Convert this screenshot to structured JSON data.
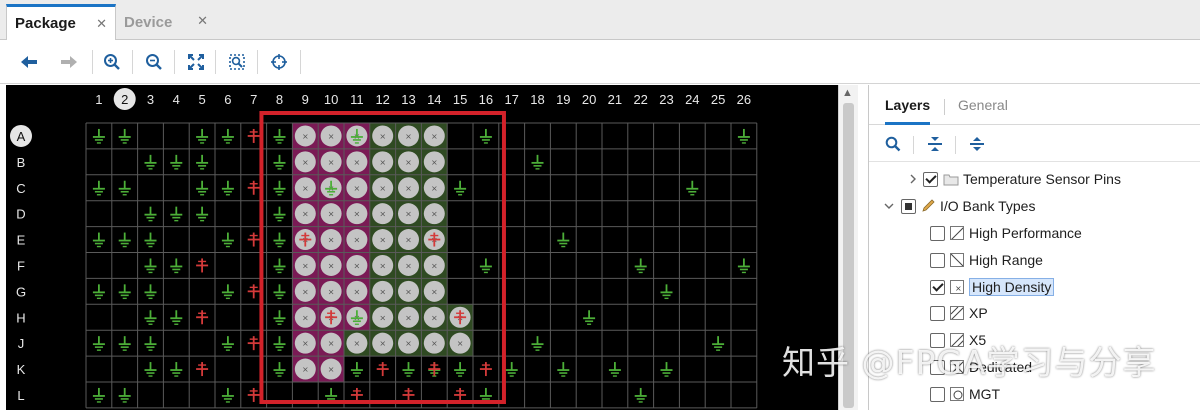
{
  "tabs": [
    {
      "label": "Package",
      "active": true
    },
    {
      "label": "Device",
      "active": false
    }
  ],
  "toolbar_icons": [
    "back-arrow-icon",
    "forward-arrow-icon",
    "zoom-in-icon",
    "zoom-out-icon",
    "zoom-fit-icon",
    "zoom-area-icon",
    "crosshair-icon"
  ],
  "package_view": {
    "columns": [
      "1",
      "2",
      "3",
      "4",
      "5",
      "6",
      "7",
      "8",
      "9",
      "10",
      "11",
      "12",
      "13",
      "14",
      "15",
      "16",
      "17",
      "18",
      "19",
      "20",
      "21",
      "22",
      "23",
      "24",
      "25",
      "26"
    ],
    "rows": [
      "A",
      "B",
      "C",
      "D",
      "E",
      "F",
      "G",
      "H",
      "J",
      "K",
      "L"
    ],
    "selected_column": "2",
    "selected_row": "A",
    "ground_pins": [
      [
        1,
        0
      ],
      [
        2,
        0
      ],
      [
        5,
        0
      ],
      [
        6,
        0
      ],
      [
        8,
        0
      ],
      [
        11,
        0
      ],
      [
        16,
        0
      ],
      [
        26,
        0
      ],
      [
        3,
        1
      ],
      [
        4,
        1
      ],
      [
        5,
        1
      ],
      [
        8,
        1
      ],
      [
        18,
        1
      ],
      [
        1,
        2
      ],
      [
        2,
        2
      ],
      [
        5,
        2
      ],
      [
        6,
        2
      ],
      [
        8,
        2
      ],
      [
        10,
        2
      ],
      [
        15,
        2
      ],
      [
        24,
        2
      ],
      [
        3,
        3
      ],
      [
        4,
        3
      ],
      [
        5,
        3
      ],
      [
        8,
        3
      ],
      [
        1,
        4
      ],
      [
        2,
        4
      ],
      [
        3,
        4
      ],
      [
        6,
        4
      ],
      [
        8,
        4
      ],
      [
        19,
        4
      ],
      [
        3,
        5
      ],
      [
        4,
        5
      ],
      [
        8,
        5
      ],
      [
        16,
        5
      ],
      [
        22,
        5
      ],
      [
        26,
        5
      ],
      [
        1,
        6
      ],
      [
        2,
        6
      ],
      [
        3,
        6
      ],
      [
        6,
        6
      ],
      [
        8,
        6
      ],
      [
        23,
        6
      ],
      [
        3,
        7
      ],
      [
        4,
        7
      ],
      [
        8,
        7
      ],
      [
        11,
        7
      ],
      [
        20,
        7
      ],
      [
        1,
        8
      ],
      [
        2,
        8
      ],
      [
        3,
        8
      ],
      [
        6,
        8
      ],
      [
        8,
        8
      ],
      [
        18,
        8
      ],
      [
        25,
        8
      ],
      [
        3,
        9
      ],
      [
        4,
        9
      ],
      [
        8,
        9
      ],
      [
        11,
        9
      ],
      [
        13,
        9
      ],
      [
        14,
        9
      ],
      [
        15,
        9
      ],
      [
        17,
        9
      ],
      [
        19,
        9
      ],
      [
        21,
        9
      ],
      [
        23,
        9
      ],
      [
        1,
        10
      ],
      [
        2,
        10
      ],
      [
        6,
        10
      ],
      [
        10,
        10
      ],
      [
        16,
        10
      ],
      [
        22,
        10
      ]
    ],
    "power_pins": [
      [
        7,
        0
      ],
      [
        7,
        2
      ],
      [
        7,
        4
      ],
      [
        5,
        5
      ],
      [
        7,
        6
      ],
      [
        5,
        7
      ],
      [
        7,
        8
      ],
      [
        9,
        4
      ],
      [
        14,
        4
      ],
      [
        10,
        7
      ],
      [
        15,
        7
      ],
      [
        5,
        9
      ],
      [
        7,
        10
      ],
      [
        12,
        9
      ],
      [
        14,
        9
      ],
      [
        16,
        9
      ],
      [
        11,
        10
      ],
      [
        13,
        10
      ],
      [
        15,
        10
      ]
    ],
    "bank_a_rows": [
      [
        0,
        9,
        11
      ],
      [
        1,
        9,
        11
      ],
      [
        2,
        9,
        11
      ],
      [
        3,
        9,
        11
      ],
      [
        4,
        9,
        11
      ],
      [
        5,
        9,
        11
      ],
      [
        6,
        9,
        11
      ],
      [
        7,
        9,
        11
      ],
      [
        8,
        9,
        11
      ],
      [
        9,
        9,
        10
      ]
    ],
    "bank_b_rows": [
      [
        0,
        12,
        14
      ],
      [
        1,
        12,
        14
      ],
      [
        2,
        12,
        14
      ],
      [
        3,
        12,
        14
      ],
      [
        4,
        12,
        14
      ],
      [
        5,
        12,
        14
      ],
      [
        6,
        12,
        14
      ],
      [
        7,
        12,
        15
      ],
      [
        8,
        11,
        15
      ]
    ],
    "colors": {
      "bank_a": "#7a1a55",
      "bank_b": "#2f4a22",
      "ground": "#4caf38",
      "power": "#d43a3a",
      "selection": "#d3222a"
    }
  },
  "layers_panel": {
    "tabs": [
      "Layers",
      "General"
    ],
    "tool_icons": [
      "search-icon",
      "collapse-all-icon",
      "expand-all-icon"
    ],
    "items": [
      {
        "label": "Temperature Sensor Pins",
        "checked": "checked",
        "level": 1,
        "expandable": true
      },
      {
        "label": "I/O Bank Types",
        "checked": "partial",
        "level": 0,
        "expandable": true
      },
      {
        "label": "High Performance",
        "checked": "unchecked",
        "level": 2
      },
      {
        "label": "High Range",
        "checked": "unchecked",
        "level": 2
      },
      {
        "label": "High Density",
        "checked": "checked",
        "level": 2,
        "highlighted": true
      },
      {
        "label": "XP",
        "checked": "unchecked",
        "level": 2
      },
      {
        "label": "X5",
        "checked": "unchecked",
        "level": 2
      },
      {
        "label": "Dedicated",
        "checked": "unchecked",
        "level": 2
      },
      {
        "label": "MGT",
        "checked": "unchecked",
        "level": 2
      }
    ]
  },
  "watermark": "知乎 @FPGA学习与分享"
}
